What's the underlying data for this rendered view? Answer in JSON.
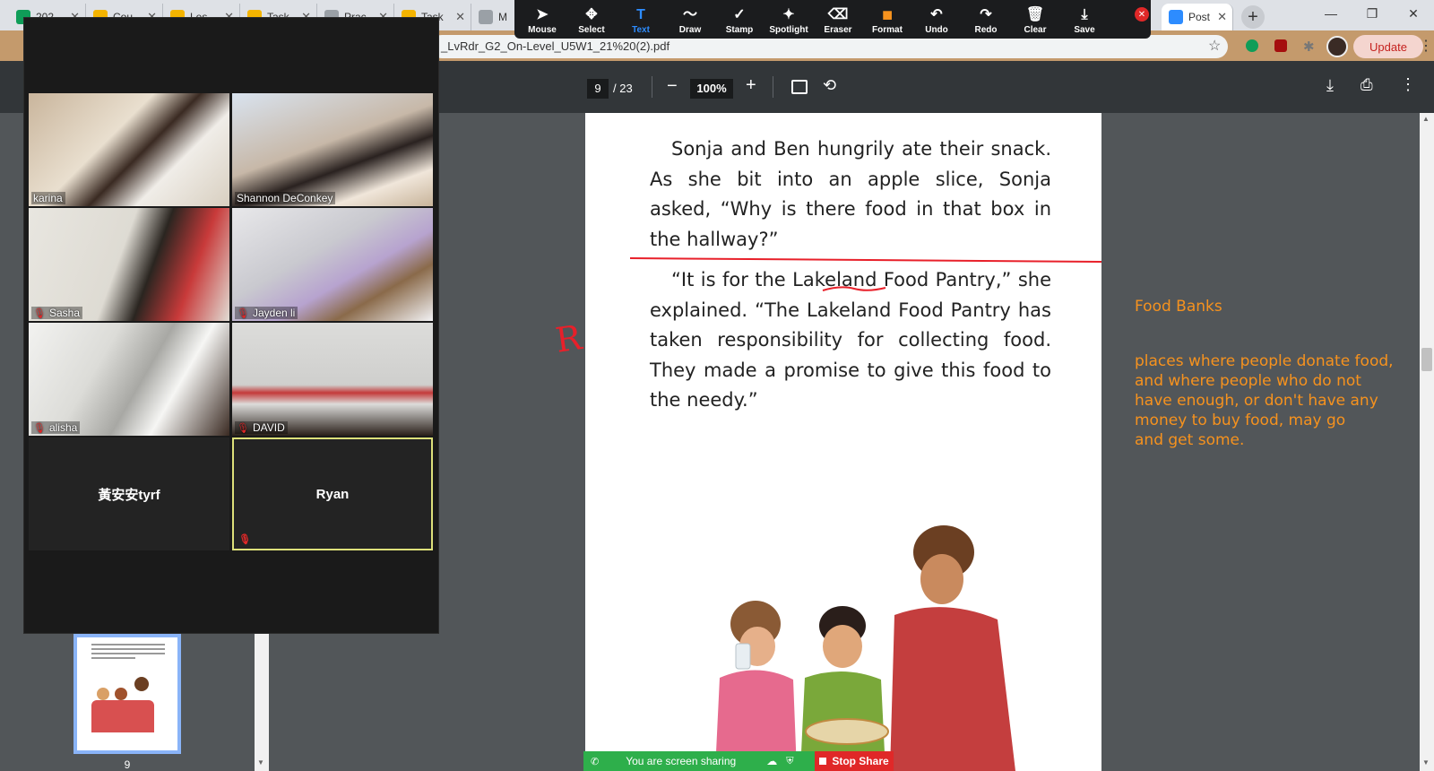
{
  "browser": {
    "tabs": [
      {
        "label": "202",
        "color": "#0f9d58"
      },
      {
        "label": "Cou",
        "color": "#f4b400"
      },
      {
        "label": "Les",
        "color": "#f4b400"
      },
      {
        "label": "Task",
        "color": "#f4b400"
      },
      {
        "label": "Prac",
        "color": "#9aa0a6"
      },
      {
        "label": "Task",
        "color": "#f4b400"
      },
      {
        "label": "M",
        "color": "#9aa0a6"
      },
      {
        "label": "Post",
        "color": "#2d8cff"
      }
    ],
    "url": "_LvRdr_G2_On-Level_U5W1_21%20(2).pdf",
    "update_label": "Update"
  },
  "annotation_toolbar": {
    "tools": [
      {
        "label": "Mouse",
        "icon": "cursor-icon",
        "glyph": "➤"
      },
      {
        "label": "Select",
        "icon": "move-icon",
        "glyph": "✥"
      },
      {
        "label": "Text",
        "icon": "text-icon",
        "glyph": "T",
        "active": true
      },
      {
        "label": "Draw",
        "icon": "squiggle-icon",
        "glyph": "〜"
      },
      {
        "label": "Stamp",
        "icon": "check-icon",
        "glyph": "✓"
      },
      {
        "label": "Spotlight",
        "icon": "wand-icon",
        "glyph": "✦"
      },
      {
        "label": "Eraser",
        "icon": "eraser-icon",
        "glyph": "⌫"
      },
      {
        "label": "Format",
        "icon": "color-swatch-icon",
        "glyph": "■"
      },
      {
        "label": "Undo",
        "icon": "undo-icon",
        "glyph": "↶"
      },
      {
        "label": "Redo",
        "icon": "redo-icon",
        "glyph": "↷"
      },
      {
        "label": "Clear",
        "icon": "trash-icon",
        "glyph": "🗑"
      },
      {
        "label": "Save",
        "icon": "save-icon",
        "glyph": "⤓"
      }
    ],
    "active_color": "#2d8cff",
    "format_color": "#f6921e"
  },
  "pdf_toolbar": {
    "current_page": "9",
    "total_pages": "/ 23",
    "zoom": "100%"
  },
  "zoom_panel": {
    "participants": [
      {
        "name": "karina",
        "muted": false,
        "video": true
      },
      {
        "name": "Shannon DeConkey",
        "muted": false,
        "video": true
      },
      {
        "name": "Sasha",
        "muted": true,
        "video": true
      },
      {
        "name": "Jayden li",
        "muted": true,
        "video": true
      },
      {
        "name": "alisha",
        "muted": true,
        "video": true
      },
      {
        "name": "DAVID",
        "muted": true,
        "video": true
      },
      {
        "name": "黃安安tyrf",
        "muted": false,
        "video": false
      },
      {
        "name": "Ryan",
        "muted": true,
        "video": false,
        "speaking": true
      }
    ]
  },
  "document": {
    "paragraph1": "Sonja and Ben hungrily ate their snack. As she bit into an apple slice, Sonja asked, “Why is there food in that box in the hallway?”",
    "paragraph2": "“It is for the Lakeland Food Pantry,” she explained. “The Lakeland Food Pantry has taken responsibility for collecting food. They made a promise to give this food to the needy.”",
    "margin_mark": "R"
  },
  "definition": {
    "heading": "Food Banks",
    "body": "places where people donate food,\nand where people who do not\nhave enough, or don't have any\nmoney to buy food, may go\nand get some."
  },
  "sidebar": {
    "thumbnail_page": "9"
  },
  "share_bar": {
    "status": "You are screen sharing",
    "stop_label": "Stop Share"
  }
}
